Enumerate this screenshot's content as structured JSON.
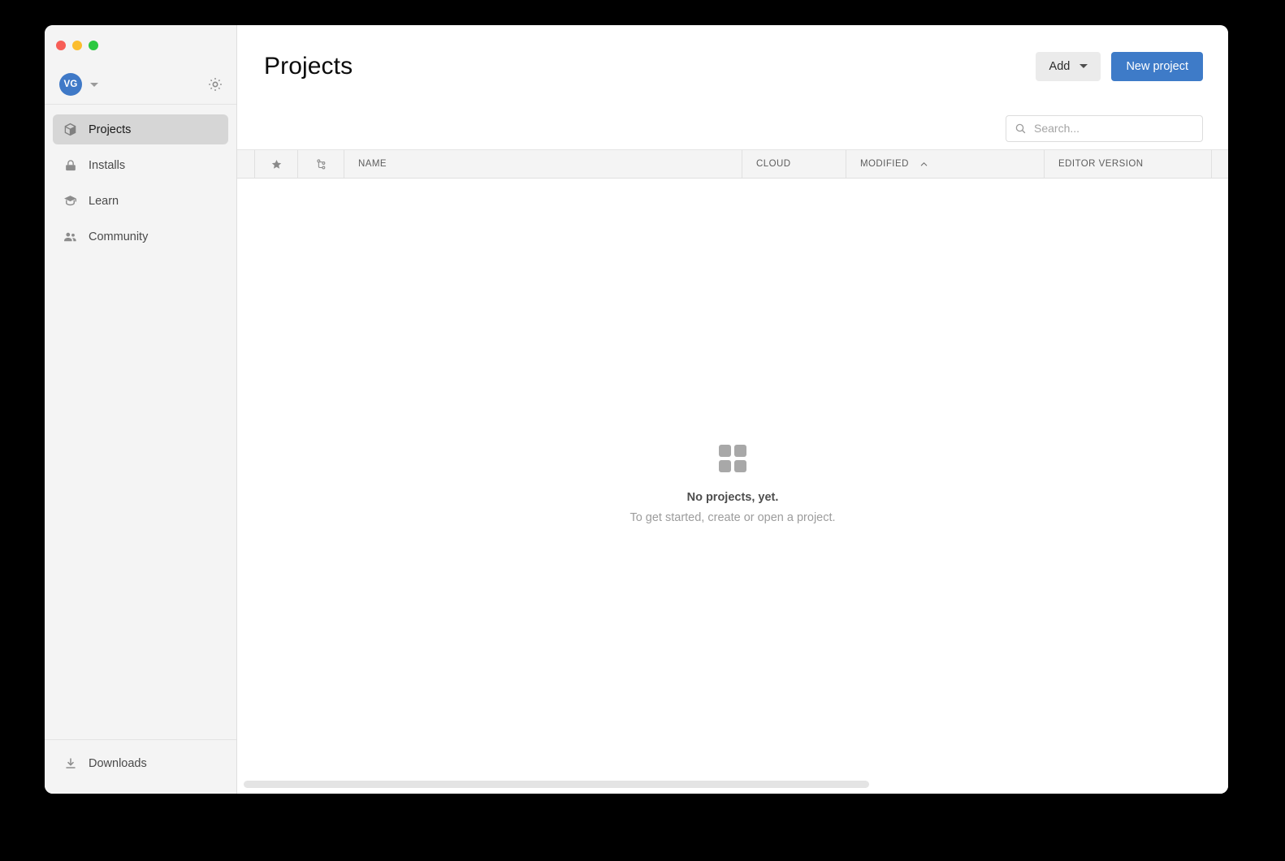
{
  "window": {
    "traffic_lights": [
      "close",
      "minimize",
      "zoom"
    ],
    "colors": {
      "accent_blue": "#3e7bc8",
      "avatar_blue": "#3f79c7",
      "sidebar_bg": "#f4f4f4",
      "active_item_bg": "#d6d6d6",
      "close": "#f75e57",
      "minimize": "#fbbd2e",
      "zoom": "#2bc840"
    }
  },
  "sidebar": {
    "account": {
      "avatar_initials": "VG",
      "caret_icon": "chevron-down-icon",
      "settings_icon": "gear-icon"
    },
    "items": [
      {
        "label": "Projects",
        "icon": "cube-icon",
        "active": true
      },
      {
        "label": "Installs",
        "icon": "lock-icon",
        "active": false
      },
      {
        "label": "Learn",
        "icon": "graduation-cap-icon",
        "active": false
      },
      {
        "label": "Community",
        "icon": "people-icon",
        "active": false
      }
    ],
    "footer": [
      {
        "label": "Downloads",
        "icon": "download-icon"
      }
    ]
  },
  "header": {
    "title": "Projects",
    "add_label": "Add",
    "add_caret_icon": "caret-down-icon",
    "new_project_label": "New project"
  },
  "search": {
    "placeholder": "Search...",
    "value": "",
    "icon": "search-icon"
  },
  "table": {
    "columns": [
      {
        "key": "spacer",
        "label": "",
        "type": "spacer"
      },
      {
        "key": "favorite",
        "label": "",
        "icon": "star-icon",
        "type": "icon"
      },
      {
        "key": "version_control",
        "label": "",
        "icon": "branch-icon",
        "type": "icon"
      },
      {
        "key": "name",
        "label": "NAME",
        "type": "text"
      },
      {
        "key": "cloud",
        "label": "CLOUD",
        "type": "text"
      },
      {
        "key": "modified",
        "label": "MODIFIED",
        "type": "text",
        "sorted": "asc",
        "sort_icon": "chevron-up-icon"
      },
      {
        "key": "editor_version",
        "label": "EDITOR VERSION",
        "type": "text"
      },
      {
        "key": "actions",
        "label": "",
        "type": "spacer"
      }
    ],
    "rows": [],
    "empty_state": {
      "icon": "grid-four-squares-icon",
      "title": "No projects, yet.",
      "subtitle": "To get started, create or open a project."
    }
  },
  "scrollbar": {
    "orientation": "horizontal",
    "thumb_name": "horizontal-scrollbar-thumb"
  }
}
